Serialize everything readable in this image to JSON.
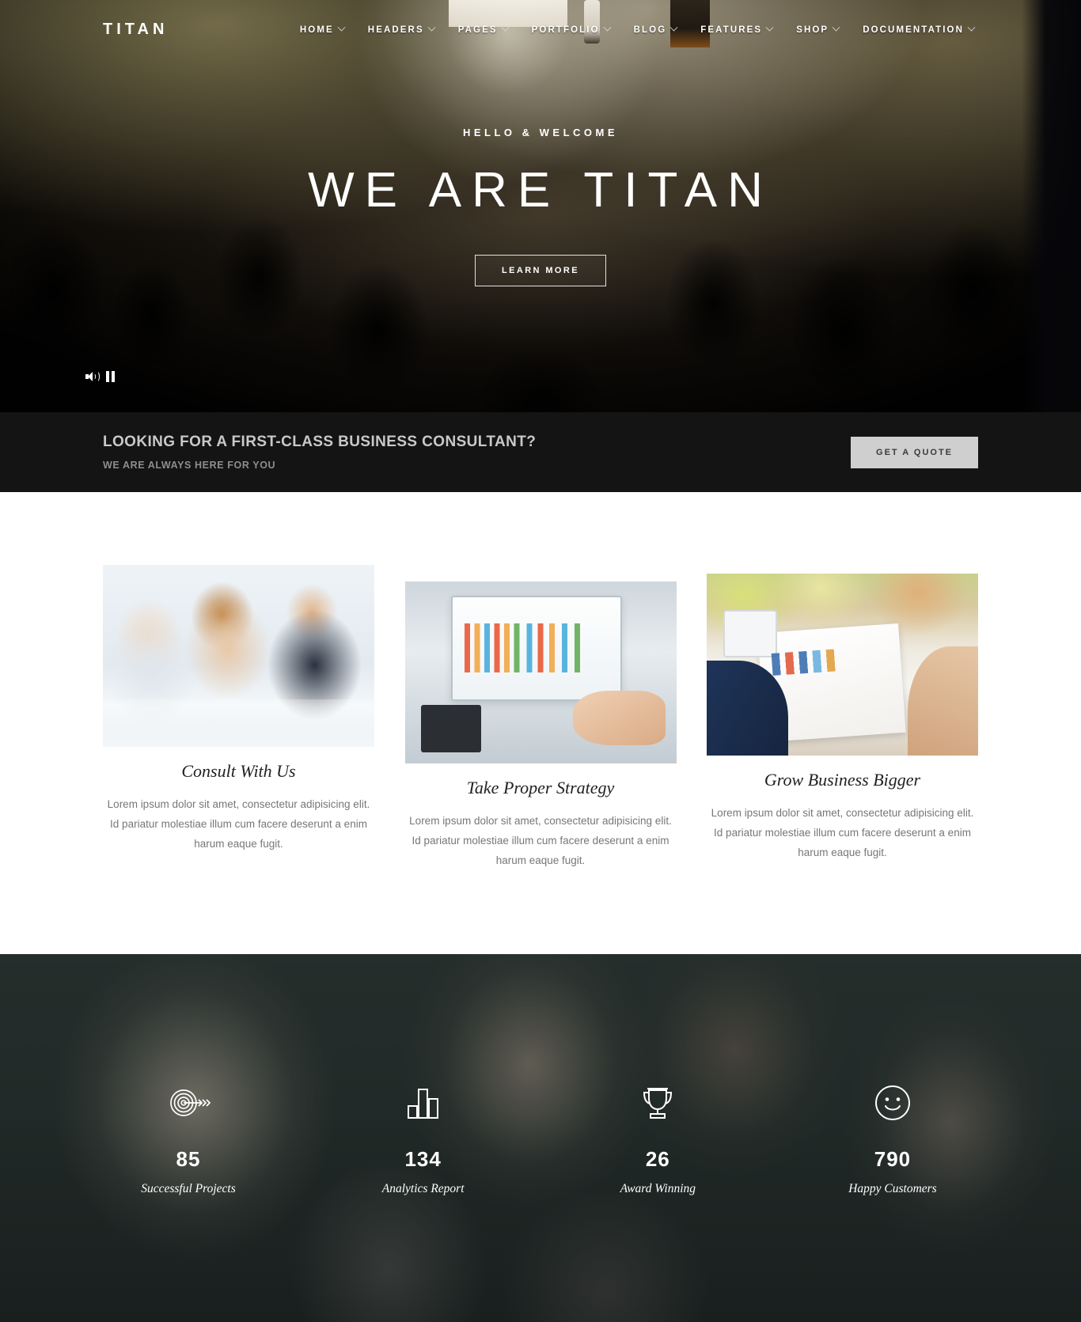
{
  "brand": "TITAN",
  "nav": {
    "items": [
      {
        "label": "HOME",
        "has_dropdown": true
      },
      {
        "label": "HEADERS",
        "has_dropdown": true
      },
      {
        "label": "PAGES",
        "has_dropdown": true
      },
      {
        "label": "PORTFOLIO",
        "has_dropdown": true
      },
      {
        "label": "BLOG",
        "has_dropdown": true
      },
      {
        "label": "FEATURES",
        "has_dropdown": true
      },
      {
        "label": "SHOP",
        "has_dropdown": true
      },
      {
        "label": "DOCUMENTATION",
        "has_dropdown": true
      }
    ]
  },
  "hero": {
    "eyebrow": "HELLO & WELCOME",
    "title": "WE ARE TITAN",
    "button": "LEARN MORE",
    "controls": {
      "volume_icon": "volume-icon",
      "pause_icon": "pause-icon"
    }
  },
  "cta": {
    "title": "LOOKING FOR A FIRST-CLASS BUSINESS CONSULTANT?",
    "subtitle": "WE ARE ALWAYS HERE FOR YOU",
    "button": "GET A QUOTE",
    "button_bg": "#cfcfcf",
    "band_bg": "#141414"
  },
  "services": {
    "cards": [
      {
        "title": "Consult With Us",
        "text": "Lorem ipsum dolor sit amet, consectetur adipisicing elit. Id pariatur molestiae illum cum facere deserunt a enim harum eaque fugit.",
        "image_alt": "business-team-meeting-photo"
      },
      {
        "title": "Take Proper Strategy",
        "text": "Lorem ipsum dolor sit amet, consectetur adipisicing elit. Id pariatur molestiae illum cum facere deserunt a enim harum eaque fugit.",
        "image_alt": "laptop-bar-chart-analysis-photo"
      },
      {
        "title": "Grow Business Bigger",
        "text": "Lorem ipsum dolor sit amet, consectetur adipisicing elit. Id pariatur molestiae illum cum facere deserunt a enim harum eaque fugit.",
        "image_alt": "reviewing-report-charts-photo"
      }
    ]
  },
  "counters": {
    "items": [
      {
        "icon": "target-arrow-icon",
        "value": "85",
        "label": "Successful Projects"
      },
      {
        "icon": "bar-chart-icon",
        "value": "134",
        "label": "Analytics Report"
      },
      {
        "icon": "trophy-icon",
        "value": "26",
        "label": "Award Winning"
      },
      {
        "icon": "smiley-face-icon",
        "value": "790",
        "label": "Happy Customers"
      }
    ]
  }
}
